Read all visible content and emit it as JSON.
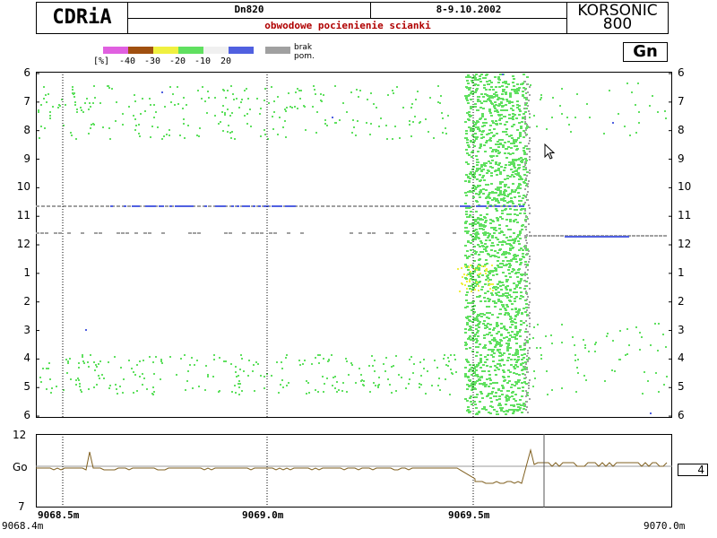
{
  "header": {
    "logo": "CDRiA",
    "pipe": "Dn820",
    "date": "8-9.10.2002",
    "description": "obwodowe pocienienie scianki",
    "brand_line1": "KORSONIC",
    "brand_line2": "800"
  },
  "legend": {
    "unit": "[%]",
    "labels": [
      "-40",
      "-30",
      "-20",
      "-10",
      "20"
    ],
    "colors": [
      "#e060e0",
      "#a05010",
      "#f0f040",
      "#60e060",
      "#f0f0f0",
      "#5060e0"
    ],
    "missing_color": "#a0a0a0",
    "missing_line1": "brak",
    "missing_line2": "pom."
  },
  "mode_button": "Gn",
  "main_plot": {
    "y_ticks": [
      "6",
      "7",
      "8",
      "9",
      "10",
      "11",
      "12",
      "1",
      "2",
      "3",
      "4",
      "5",
      "6"
    ]
  },
  "bottom_plot": {
    "y_ticks": [
      "12",
      "Go",
      "7"
    ],
    "gauge_value": "4"
  },
  "x_axis": {
    "tick_labels": [
      "9068.5m",
      "9069.0m",
      "9069.5m"
    ],
    "start": "9068.4m",
    "end": "9070.0m"
  },
  "colors": {
    "grid_dot": "#000000",
    "trace": "#806020",
    "background": "#ffffff"
  }
}
